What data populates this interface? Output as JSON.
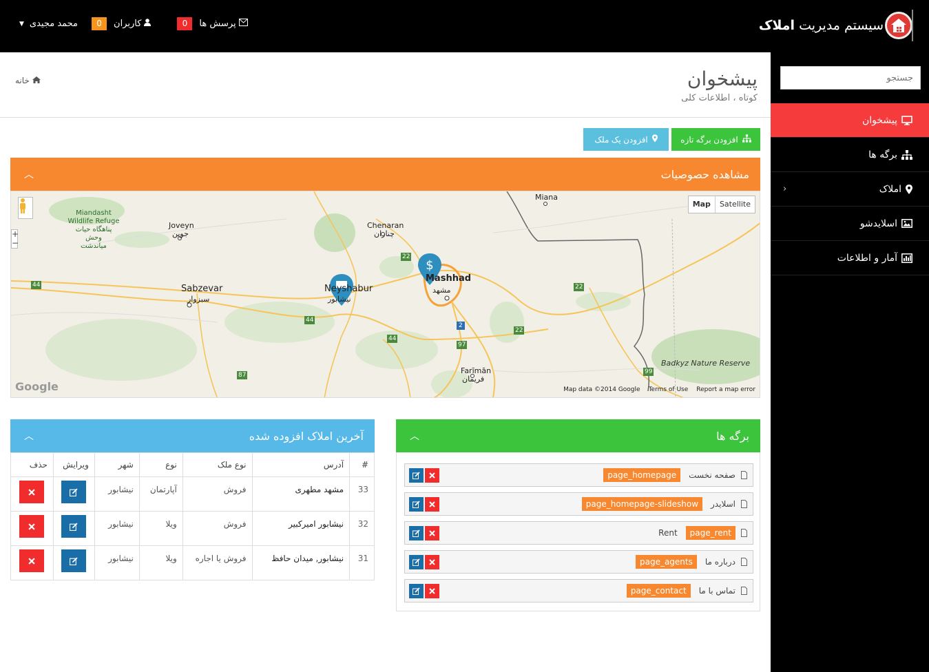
{
  "header": {
    "brand_title_prefix": "سیستم مدیریت",
    "brand_title_bold": "املاک",
    "messages_label": "پرسش ها",
    "messages_count": "0",
    "users_label": "کاربران",
    "users_count": "0",
    "user_name": "محمد مجیدی"
  },
  "sidebar": {
    "search_placeholder": "جستجو",
    "items": [
      {
        "label": "پیشخوان",
        "icon": "monitor-icon",
        "active": true
      },
      {
        "label": "برگه ها",
        "icon": "sitemap-icon"
      },
      {
        "label": "املاک",
        "icon": "map-marker-icon",
        "has_submenu": true
      },
      {
        "label": "اسلایدشو",
        "icon": "picture-icon"
      },
      {
        "label": "آمار و اطلاعات",
        "icon": "bar-chart-icon"
      }
    ]
  },
  "page": {
    "title": "پیشخوان",
    "subtitle": "کوتاه ، اطلاعات کلی",
    "breadcrumb_home": "خانه"
  },
  "actions": {
    "add_page": "افزودن برگه تازه",
    "add_property": "افزودن یک ملک"
  },
  "map_panel": {
    "title": "مشاهده حصوصیات",
    "map_type_map": "Map",
    "map_type_satellite": "Satellite",
    "footer_data": "Map data ©2014 Google",
    "footer_terms": "Terms of Use",
    "footer_report": "Report a map error",
    "google_logo": "Google",
    "labels": {
      "miana": "Miana",
      "chenaran": "Chenaran",
      "chenaran_fa": "چناران",
      "joveyn": "Joveyn",
      "joveyn_fa": "جوین",
      "miandasht": "Miandasht Wildlife Refuge",
      "miandasht_fa": "پناهگاه حیات وحش میاندشت",
      "sabzevar": "Sabzevar",
      "sabzevar_fa": "سبزوار",
      "neyshabur": "Neyshabur",
      "neyshabur_fa": "نیشابور",
      "mashhad": "Mashhad",
      "mashhad_fa": "مشهد",
      "fariman": "Farīmān",
      "fariman_fa": "فریمان",
      "badkyz": "Badkyz Nature Reserve",
      "r22a": "22",
      "r22b": "22",
      "r22c": "22",
      "r44a": "44",
      "r44b": "44",
      "r44c": "44",
      "r87": "87",
      "r97": "97",
      "r99": "99",
      "r2": "2"
    }
  },
  "pages_panel": {
    "title": "برگه ها",
    "items": [
      {
        "name": "صفحه نخست",
        "slug": "page_homepage"
      },
      {
        "name": "اسلایدر",
        "slug": "page_homepage-slideshow"
      },
      {
        "name": "Rent",
        "slug": "page_rent"
      },
      {
        "name": "درباره ما",
        "slug": "page_agents"
      },
      {
        "name": "تماس با ما",
        "slug": "page_contact"
      }
    ]
  },
  "properties_panel": {
    "title": "آخرین املاک افزوده شده",
    "columns": [
      "#",
      "آدرس",
      "نوع ملک",
      "نوع",
      "شهر",
      "ویرایش",
      "حذف"
    ],
    "rows": [
      {
        "id": "33",
        "address": "مشهد مطهری",
        "deal": "فروش",
        "type": "آپارتمان",
        "city": "نیشابور"
      },
      {
        "id": "32",
        "address": "نیشابور امیرکبیر",
        "deal": "فروش",
        "type": "ویلا",
        "city": "نیشابور"
      },
      {
        "id": "31",
        "address": "نیشابور, میدان حافظ",
        "deal": "فروش یا اجاره",
        "type": "ویلا",
        "city": "نیشابور"
      }
    ]
  },
  "colors": {
    "accent_red": "#f53b3b",
    "orange": "#f7882f",
    "green": "#3cc43c",
    "blue": "#56b9e8"
  }
}
